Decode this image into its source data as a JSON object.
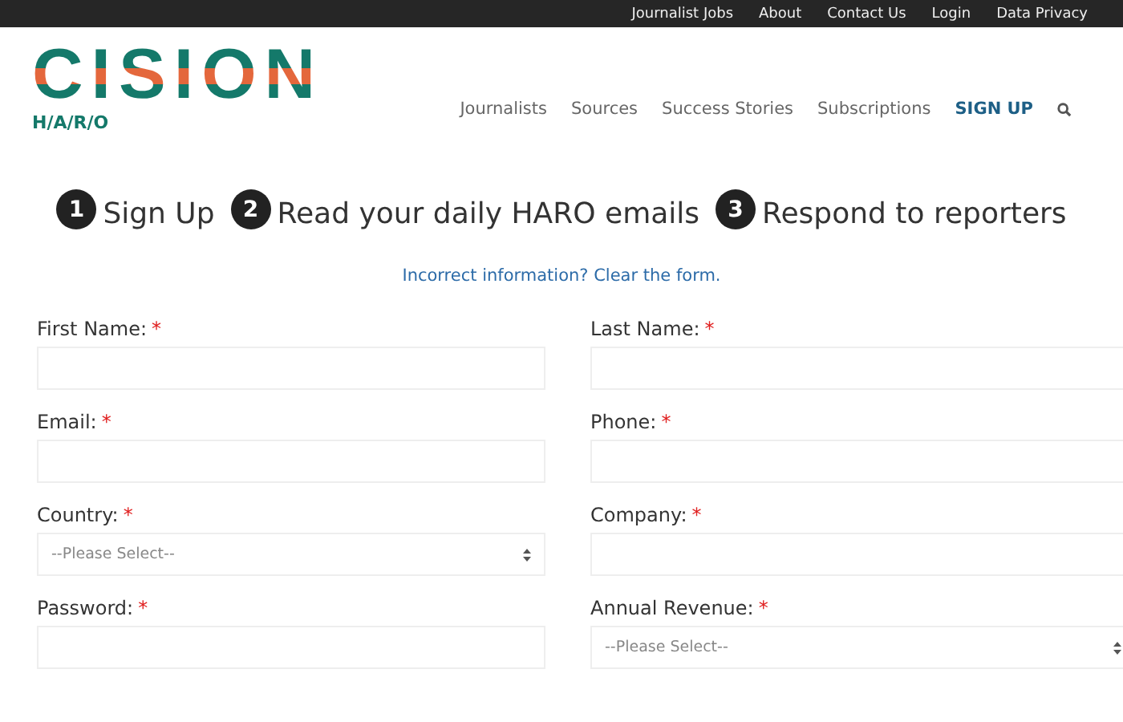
{
  "top_bar": {
    "links": [
      "Journalist Jobs",
      "About",
      "Contact Us",
      "Login",
      "Data Privacy"
    ]
  },
  "logo": {
    "name": "CISION",
    "sub": "H/A/R/O"
  },
  "nav": [
    {
      "label": "Journalists",
      "selected": false
    },
    {
      "label": "Sources",
      "selected": false
    },
    {
      "label": "Success Stories",
      "selected": false
    },
    {
      "label": "Subscriptions",
      "selected": false
    },
    {
      "label": "SIGN UP",
      "selected": true
    }
  ],
  "steps": [
    {
      "number": "1",
      "label": "Sign Up"
    },
    {
      "number": "2",
      "label": "Read your daily HARO emails"
    },
    {
      "number": "3",
      "label": "Respond to reporters"
    }
  ],
  "clear_link": "Incorrect information? Clear the form.",
  "fields": [
    {
      "label": "First Name:",
      "required_mark": "*",
      "kind": "text"
    },
    {
      "label": "Last Name:",
      "required_mark": "*",
      "kind": "text"
    },
    {
      "label": "Email:",
      "required_mark": "*",
      "kind": "text"
    },
    {
      "label": "Phone:",
      "required_mark": "*",
      "kind": "text"
    },
    {
      "label": "Country:",
      "required_mark": "*",
      "kind": "select",
      "placeholder": "--Please Select--"
    },
    {
      "label": "Company:",
      "required_mark": "*",
      "kind": "text"
    },
    {
      "label": "Password:",
      "required_mark": "*",
      "kind": "text"
    },
    {
      "label": "Annual Revenue:",
      "required_mark": "*",
      "kind": "select",
      "placeholder": "--Please Select--"
    }
  ]
}
